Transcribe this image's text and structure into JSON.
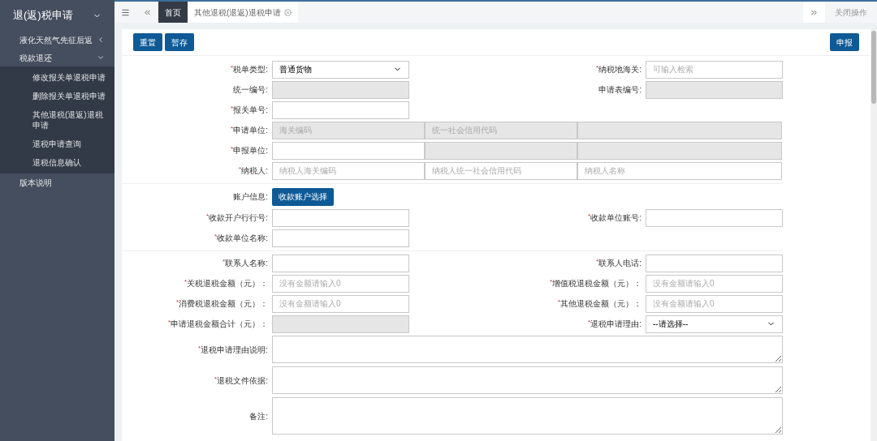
{
  "sidebar": {
    "title": "退(返)税申请",
    "items": [
      {
        "label": "液化天然气先征后返",
        "expanded": false
      },
      {
        "label": "税款退还",
        "expanded": true,
        "children": [
          {
            "label": "修改报关单退税申请"
          },
          {
            "label": "删除报关单退税申请"
          },
          {
            "label": "其他退税(退返)退税申请"
          },
          {
            "label": "退税申请查询"
          },
          {
            "label": "退税信息确认"
          }
        ]
      },
      {
        "label": "版本说明"
      }
    ]
  },
  "tab_bar": {
    "tabs": [
      {
        "label": "首页",
        "selected": false,
        "closable": false
      },
      {
        "label": "其他退税(退返)退税申请",
        "selected": true,
        "closable": true
      }
    ],
    "close_label": "关闭操作"
  },
  "toolbar": {
    "left_buttons": [
      "重置",
      "暂存"
    ],
    "right_button": "申报"
  },
  "form": {
    "required_mark": "*",
    "sections": [
      {
        "rows": [
          {
            "kind": "pair",
            "left": {
              "label": "税单类型:",
              "required": true,
              "kind": "select",
              "value": "普通货物"
            },
            "right": {
              "label": "纳税地海关:",
              "required": true,
              "kind": "input",
              "placeholder": "可输入检索"
            }
          },
          {
            "kind": "pair",
            "left": {
              "label": "统一编号:",
              "required": false,
              "kind": "input",
              "disabled": true
            },
            "right": {
              "label": "申请表编号:",
              "required": false,
              "kind": "input",
              "disabled": true
            }
          },
          {
            "kind": "pair",
            "left": {
              "label": "报关单号:",
              "required": true,
              "kind": "input"
            }
          },
          {
            "kind": "triple",
            "label": "申请单位:",
            "required": true,
            "fields": [
              {
                "placeholder": "海关编码",
                "disabled": true
              },
              {
                "placeholder": "统一社会信用代码",
                "disabled": true
              },
              {
                "disabled": true
              }
            ]
          },
          {
            "kind": "triple",
            "label": "申报单位:",
            "required": true,
            "fields": [
              {
                "disabled": false
              },
              {
                "disabled": true
              },
              {
                "disabled": true
              }
            ]
          },
          {
            "kind": "triple",
            "label": "纳税人:",
            "required": true,
            "fields": [
              {
                "placeholder": "纳税人海关编码",
                "disabled": false
              },
              {
                "placeholder": "纳税人统一社会信用代码",
                "disabled": false
              },
              {
                "placeholder": "纳税人名称",
                "disabled": false
              }
            ]
          }
        ]
      },
      {
        "rows": [
          {
            "kind": "button",
            "label": "账户信息:",
            "required": false,
            "button": "收款账户选择"
          },
          {
            "kind": "pair",
            "left": {
              "label": "收款开户行行号:",
              "required": true,
              "kind": "input"
            },
            "right": {
              "label": "收款单位账号:",
              "required": true,
              "kind": "input"
            }
          },
          {
            "kind": "pair",
            "left": {
              "label": "收款单位名称:",
              "required": true,
              "kind": "input"
            }
          }
        ]
      },
      {
        "rows": [
          {
            "kind": "pair",
            "left": {
              "label": "联系人名称:",
              "required": true,
              "kind": "input"
            },
            "right": {
              "label": "联系人电话:",
              "required": true,
              "kind": "input"
            }
          },
          {
            "kind": "pair",
            "left": {
              "label": "关税退税金额（元）：",
              "required": true,
              "kind": "input",
              "placeholder": "没有金额请输入0"
            },
            "right": {
              "label": "增值税退税金额（元）：",
              "required": true,
              "kind": "input",
              "placeholder": "没有金额请输入0"
            }
          },
          {
            "kind": "pair",
            "left": {
              "label": "消费税退税金额（元）：",
              "required": true,
              "kind": "input",
              "placeholder": "没有金额请输入0"
            },
            "right": {
              "label": "其他退税金额（元）：",
              "required": true,
              "kind": "input",
              "placeholder": "没有金额请输入0"
            }
          },
          {
            "kind": "pair",
            "left": {
              "label": "申请退税金额合计（元）：",
              "required": true,
              "kind": "input",
              "disabled": true
            },
            "right": {
              "label": "退税申请理由:",
              "required": true,
              "kind": "select",
              "value": "--请选择--"
            }
          },
          {
            "kind": "textarea",
            "label": "退税申请理由说明:",
            "required": true
          },
          {
            "kind": "textarea",
            "label": "退税文件依据:",
            "required": true
          },
          {
            "kind": "large_textarea",
            "label": "备注:",
            "required": false
          }
        ]
      }
    ]
  }
}
